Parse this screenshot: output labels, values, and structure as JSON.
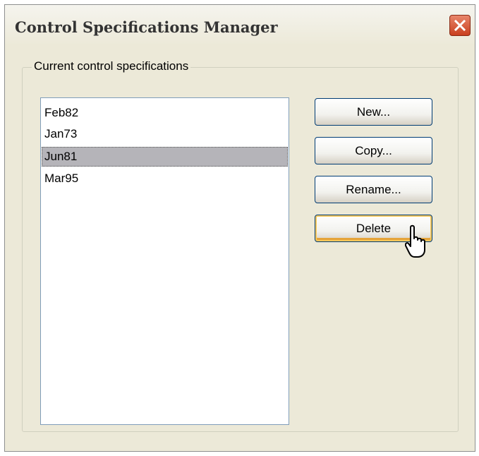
{
  "window": {
    "title": "Control Specifications Manager"
  },
  "group": {
    "label": "Current control specifications"
  },
  "list": {
    "items": [
      {
        "label": "Feb82",
        "selected": false
      },
      {
        "label": "Jan73",
        "selected": false
      },
      {
        "label": "Jun81",
        "selected": true
      },
      {
        "label": "Mar95",
        "selected": false
      }
    ]
  },
  "buttons": {
    "new_label": "New...",
    "copy_label": "Copy...",
    "rename_label": "Rename...",
    "delete_label": "Delete"
  },
  "icons": {
    "close": "close-icon",
    "cursor": "hand-pointer-cursor-icon"
  },
  "colors": {
    "dialog_bg": "#ece9d8",
    "close_button": "#c9401f",
    "selection_bg": "#b5b4b9",
    "button_border": "#003c74",
    "focus_highlight": "#f5c75c"
  }
}
